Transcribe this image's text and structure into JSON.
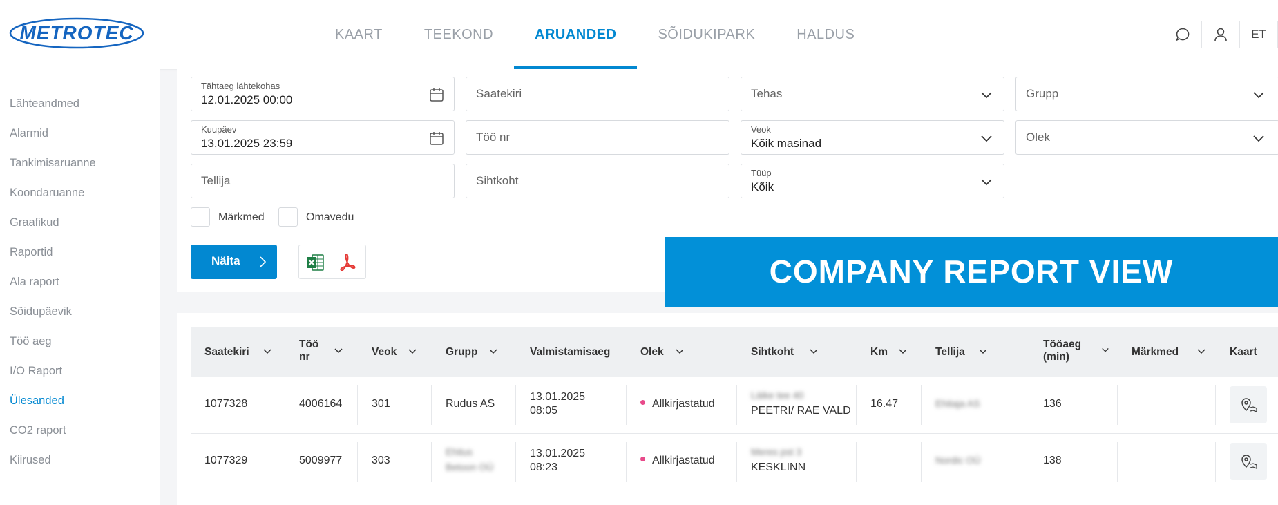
{
  "header": {
    "logo_text": "METROTEC",
    "nav": [
      {
        "label": "KAART"
      },
      {
        "label": "TEEKOND"
      },
      {
        "label": "ARUANDED",
        "active": true
      },
      {
        "label": "SÕIDUKIPARK"
      },
      {
        "label": "HALDUS"
      }
    ],
    "lang": "ET"
  },
  "sidebar": {
    "items": [
      {
        "label": "Lähteandmed"
      },
      {
        "label": "Alarmid"
      },
      {
        "label": "Tankimisaruanne"
      },
      {
        "label": "Koondaruanne"
      },
      {
        "label": "Graafikud"
      },
      {
        "label": "Raportid"
      },
      {
        "label": "Ala raport"
      },
      {
        "label": "Sõidupäevik"
      },
      {
        "label": "Töö aeg"
      },
      {
        "label": "I/O Raport"
      },
      {
        "label": "Ülesanded",
        "active": true
      },
      {
        "label": "CO2 raport"
      },
      {
        "label": "Kiirused"
      }
    ]
  },
  "filters": {
    "start_date": {
      "label": "Tähtaeg lähtekohas",
      "value": "12.01.2025 00:00"
    },
    "end_date": {
      "label": "Kuupäev",
      "value": "13.01.2025 23:59"
    },
    "client": {
      "placeholder": "Tellija"
    },
    "waybill": {
      "placeholder": "Saatekiri"
    },
    "job_no": {
      "placeholder": "Töö nr"
    },
    "destination": {
      "placeholder": "Sihtkoht"
    },
    "factory": {
      "placeholder": "Tehas"
    },
    "vehicle": {
      "label": "Veok",
      "value": "Kõik masinad"
    },
    "type": {
      "label": "Tüüp",
      "value": "Kõik"
    },
    "group": {
      "placeholder": "Grupp"
    },
    "status": {
      "placeholder": "Olek"
    },
    "checkbox_notes": "Märkmed",
    "checkbox_own": "Omavedu",
    "show_button": "Näita"
  },
  "banner": "COMPANY REPORT VIEW",
  "table": {
    "columns": [
      "Saatekiri",
      "Töö nr",
      "Veok",
      "Grupp",
      "Valmistamisaeg",
      "Olek",
      "Sihtkoht",
      "Km",
      "Tellija",
      "Tööaeg (min)",
      "Märkmed",
      "Kaart"
    ],
    "rows": [
      {
        "saatekiri": "1077328",
        "too_nr": "4006164",
        "veok": "301",
        "grupp": "Rudus AS",
        "date": "13.01.2025",
        "time": "08:05",
        "olek": "Allkirjastatud",
        "sihtkoht_blur": "Läike tee 40",
        "sihtkoht": "PEETRI/ RAE VALD",
        "km": "16.47",
        "tellija_blur": "Ehitaja AS",
        "tooaeg": "136"
      },
      {
        "saatekiri": "1077329",
        "too_nr": "5009977",
        "veok": "303",
        "grupp_blur_1": "Ehitus",
        "grupp_blur_2": "Betoon OÜ",
        "date": "13.01.2025",
        "time": "08:23",
        "olek": "Allkirjastatud",
        "sihtkoht_blur": "Meres pst 3",
        "sihtkoht": "KESKLINN",
        "km": "",
        "tellija_blur": "Nordic OÜ",
        "tooaeg": "138"
      }
    ]
  },
  "colors": {
    "accent": "#0288d1",
    "banner": "#0290d8",
    "status_dot": "#e84a8a"
  }
}
